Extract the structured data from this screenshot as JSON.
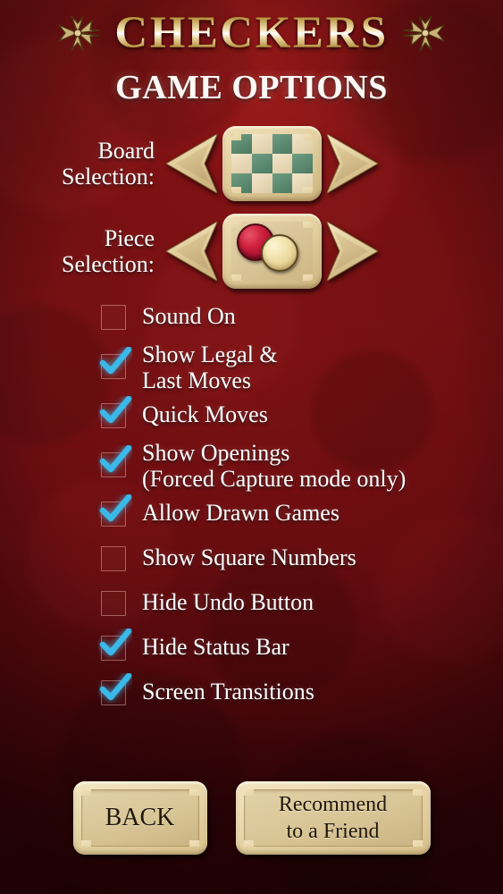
{
  "header": {
    "game_title": "CHECKERS",
    "subtitle": "GAME OPTIONS",
    "ornament_left": "fleur-ornament-left",
    "ornament_right": "fleur-ornament-right",
    "title_gold": "#e8d29a",
    "subtitle_color": "#fdf8f5"
  },
  "selectors": [
    {
      "label_line1": "Board",
      "label_line2": "Selection:",
      "prev_label": "previous-board",
      "next_label": "next-board",
      "preview_type": "checkerboard",
      "light_color": "#e8d8b2",
      "dark_color": "#5a8a6e"
    },
    {
      "label_line1": "Piece",
      "label_line2": "Selection:",
      "prev_label": "previous-piece",
      "next_label": "next-piece",
      "preview_type": "pieces",
      "piece_dark_color": "#cf1f3e",
      "piece_light_color": "#f2e3ad"
    }
  ],
  "options": [
    {
      "label_line1": "Sound On",
      "label_line2": "",
      "checked": false
    },
    {
      "label_line1": "Show Legal &",
      "label_line2": "Last Moves",
      "checked": true
    },
    {
      "label_line1": "Quick Moves",
      "label_line2": "",
      "checked": true
    },
    {
      "label_line1": "Show Openings",
      "label_line2": "(Forced Capture mode only)",
      "checked": true
    },
    {
      "label_line1": "Allow Drawn Games",
      "label_line2": "",
      "checked": true
    },
    {
      "label_line1": "Show Square Numbers",
      "label_line2": "",
      "checked": false
    },
    {
      "label_line1": "Hide Undo Button",
      "label_line2": "",
      "checked": false
    },
    {
      "label_line1": "Hide Status Bar",
      "label_line2": "",
      "checked": true
    },
    {
      "label_line1": "Screen Transitions",
      "label_line2": "",
      "checked": true
    }
  ],
  "checkmark_color": "#3ab8e8",
  "buttons": {
    "back_label": "BACK",
    "recommend_line1": "Recommend",
    "recommend_line2": "to a Friend"
  }
}
